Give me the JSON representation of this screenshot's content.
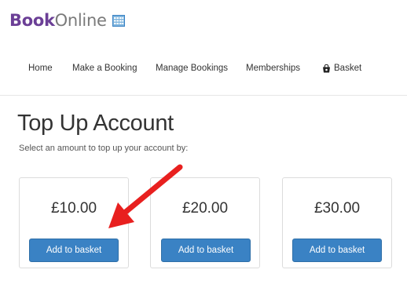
{
  "app": {
    "logo_part1": "Book",
    "logo_part2": "Online",
    "brand_color": "#6b3f96"
  },
  "nav": {
    "items": [
      {
        "label": "Home"
      },
      {
        "label": "Make a Booking"
      },
      {
        "label": "Manage Bookings"
      },
      {
        "label": "Memberships"
      },
      {
        "label": "Basket",
        "icon": "basket-icon"
      }
    ]
  },
  "main": {
    "title": "Top Up Account",
    "subtitle": "Select an amount to top up your account by:",
    "options": [
      {
        "price": "£10.00",
        "button_label": "Add to basket"
      },
      {
        "price": "£20.00",
        "button_label": "Add to basket"
      },
      {
        "price": "£30.00",
        "button_label": "Add to basket"
      }
    ]
  },
  "annotation": {
    "icon": "red-arrow-icon",
    "color": "#e8201f"
  },
  "colors": {
    "button": "#3a82c4",
    "text": "#333333"
  }
}
